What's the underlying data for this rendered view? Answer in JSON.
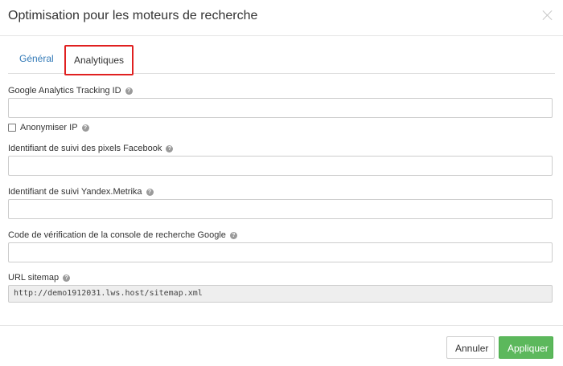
{
  "modal": {
    "title": "Optimisation pour les moteurs de recherche"
  },
  "tabs": [
    {
      "label": "Général"
    },
    {
      "label": "Analytiques"
    }
  ],
  "fields": {
    "ga": {
      "label": "Google Analytics Tracking ID",
      "value": ""
    },
    "anonymize": {
      "label": "Anonymiser IP",
      "checked": false
    },
    "fb": {
      "label": "Identifiant de suivi des pixels Facebook",
      "value": ""
    },
    "yandex": {
      "label": "Identifiant de suivi Yandex.Metrika",
      "value": ""
    },
    "gsc": {
      "label": "Code de vérification de la console de recherche Google",
      "value": ""
    },
    "sitemap": {
      "label": "URL sitemap",
      "value": "http://demo1912031.lws.host/sitemap.xml"
    }
  },
  "help_icon": "?",
  "buttons": {
    "cancel": "Annuler",
    "apply": "Appliquer"
  },
  "colors": {
    "link": "#337ab7",
    "highlight_border": "#e02020",
    "apply": "#5cb85c"
  }
}
